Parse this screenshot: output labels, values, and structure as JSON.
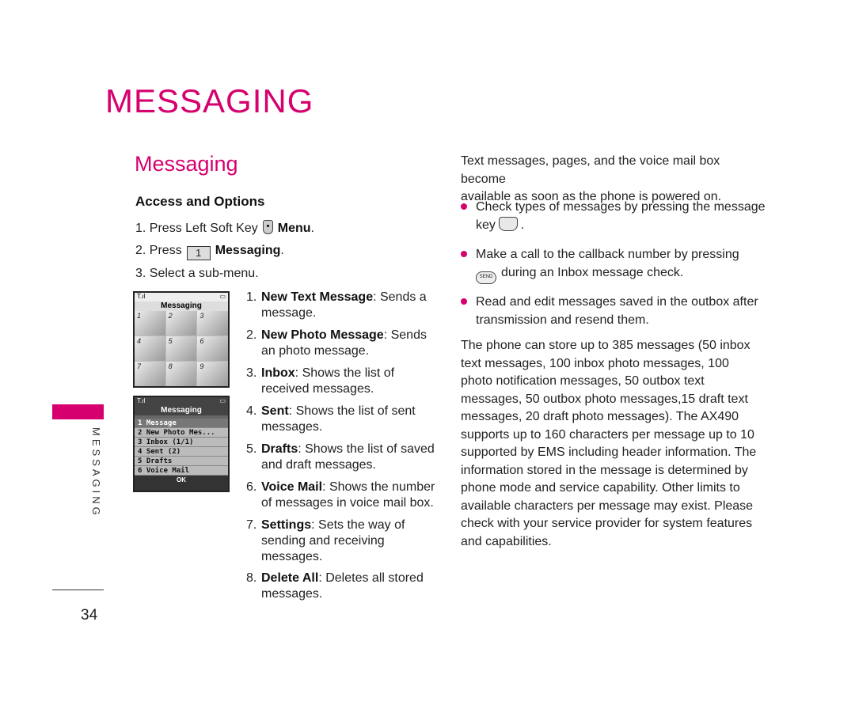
{
  "chapter_title": "MESSAGING",
  "section_title": "Messaging",
  "subheading": "Access and Options",
  "steps": [
    {
      "num": "1.",
      "pre": "Press Left Soft Key",
      "key": "soft-key",
      "bold": "Menu",
      "post": "."
    },
    {
      "num": "2.",
      "pre": "Press",
      "key_label": "1",
      "bold": "Messaging",
      "post": "."
    },
    {
      "num": "3.",
      "text": "Select a sub-menu."
    }
  ],
  "submenu": [
    {
      "num": "1.",
      "name": "New Text Message",
      "lines": [
        ": Sends a",
        "message."
      ]
    },
    {
      "num": "2.",
      "name": "New Photo Message",
      "lines": [
        ": Sends",
        "an photo message."
      ]
    },
    {
      "num": "3.",
      "name": "Inbox",
      "lines": [
        ": Shows the list of",
        "received messages."
      ]
    },
    {
      "num": "4.",
      "name": "Sent",
      "lines": [
        ": Shows the list of sent",
        "messages."
      ]
    },
    {
      "num": "5.",
      "name": "Drafts",
      "lines": [
        ": Shows the list of saved",
        "and draft messages."
      ]
    },
    {
      "num": "6.",
      "name": "Voice Mail",
      "lines": [
        ": Shows the number",
        "of messages in voice mail box."
      ]
    },
    {
      "num": "7.",
      "name": "Settings",
      "lines": [
        ": Sets the way of",
        "sending and receiving",
        "messages."
      ]
    },
    {
      "num": "8.",
      "name": "Delete All",
      "lines": [
        ": Deletes all stored",
        "messages."
      ]
    }
  ],
  "phone1": {
    "title": "Messaging",
    "signal": "T.ıl",
    "battery": "▭",
    "icons": [
      "1",
      "2",
      "3",
      "4",
      "5",
      "6",
      "7",
      "8",
      "9"
    ]
  },
  "phone2": {
    "title": "Messaging",
    "signal": "T.ıl",
    "battery": "▭",
    "items": [
      "1 Message",
      "2 New Photo Mes...",
      "3 Inbox (1/1)",
      "4 Sent (2)",
      "5 Drafts",
      "6 Voice Mail"
    ],
    "ok": "OK"
  },
  "intro_lines": [
    "Text messages, pages, and the voice mail box become",
    "available as soon as the phone is powered on."
  ],
  "bullets": [
    {
      "line1": "Check types of messages by pressing the message",
      "line2_pre": "key",
      "line2_post": "."
    },
    {
      "line1": "Make a call to the callback number by pressing",
      "key_label": "SEND",
      "line2_post": "during an Inbox message check."
    },
    {
      "line1": "Read and edit messages saved in the outbox after",
      "line2_post": "transmission and resend them."
    }
  ],
  "storage_lines": [
    "The phone can store up to 385 messages (50 inbox",
    "text messages, 100 inbox photo messages, 100",
    "photo notification messages, 50 outbox text",
    "messages, 50 outbox photo messages,15 draft text",
    "messages, 20 draft photo messages). The AX490",
    "supports up to 160 characters per message up to 10",
    "supported by EMS including header information. The",
    "information stored in the message is determined by",
    "phone mode and service capability. Other limits to",
    "available characters per message may exist. Please",
    "check with your service provider for system features",
    "and capabilities."
  ],
  "side_tab": "MESSAGING",
  "page_number": "34",
  "accent_color": "#d6006f"
}
